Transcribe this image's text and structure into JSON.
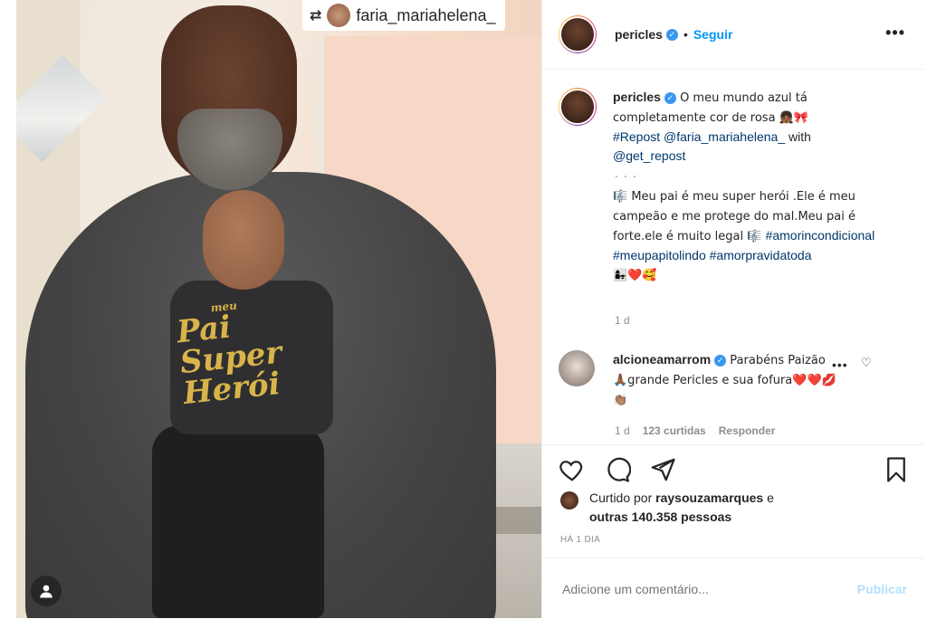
{
  "photo": {
    "repost_handle": "faria_mariahelena_",
    "onesie_line1": "Pai",
    "onesie_small": "meu",
    "onesie_line2": "Super Herói"
  },
  "header": {
    "username": "pericles",
    "follow_label": "Seguir",
    "more_label": "•••"
  },
  "caption": {
    "username": "pericles",
    "line1": " O meu mundo azul tá completamente cor de rosa 👧🏾🎀",
    "repost_tag": "#Repost",
    "repost_mention": "@faria_mariahelena_",
    "with_word": " with ",
    "getrepost": "@get_repost",
    "dots": "・・・",
    "body": "🎼 Meu pai é meu super herói .Ele é meu campeão e me protege do mal.Meu pai é forte.ele é muito legal 🎼 ",
    "tag1": "#amorincondicional",
    "tag2": "#meupapitolindo",
    "tag3": "#amorpravidatoda",
    "end_emojis": "👩‍👧❤️🥰",
    "time": "1 d"
  },
  "comment": {
    "username": "alcioneamarrom",
    "text": " Parabéns Paizão🙏🏾grande Pericles e sua fofura❤️❤️💋👏🏽",
    "time": "1 d",
    "likes": "123 curtidas",
    "reply": "Responder",
    "opts": "•••"
  },
  "likes": {
    "prefix": "Curtido por ",
    "user": "raysouzamarques",
    "mid": " e ",
    "others": "outras 140.358 pessoas"
  },
  "ago": "HÁ 1 DIA",
  "add_comment": {
    "placeholder": "Adicione um comentário...",
    "publish": "Publicar"
  }
}
